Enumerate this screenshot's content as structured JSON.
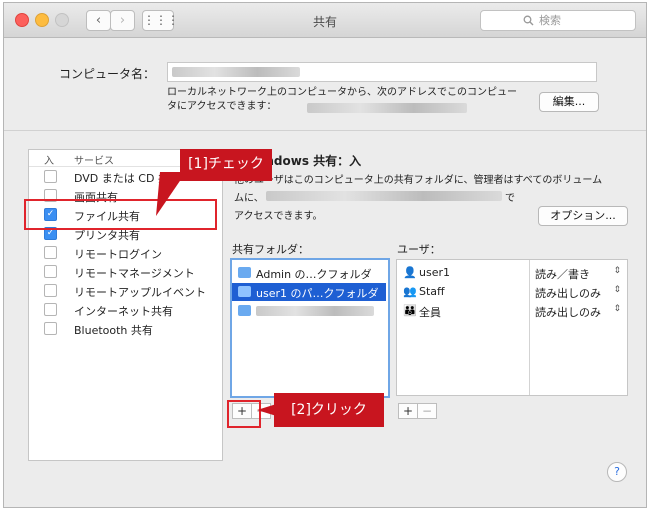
{
  "window": {
    "title": "共有",
    "search_placeholder": "検索",
    "search_icon": "magnifier-icon",
    "nav_back": "‹",
    "nav_forward": "›",
    "grid": "⋮⋮⋮"
  },
  "computer": {
    "name_label": "コンピュータ名：",
    "description": "ローカルネットワーク上のコンピュータから、次のアドレスでこのコンピュータにアクセスできます：",
    "edit_button": "編集..."
  },
  "services": {
    "header_on": "入",
    "header_service": "サービス",
    "items": [
      {
        "label": "DVD または CD 共有",
        "checked": false
      },
      {
        "label": "画面共有",
        "checked": false
      },
      {
        "label": "ファイル共有",
        "checked": true
      },
      {
        "label": "プリンタ共有",
        "checked": true
      },
      {
        "label": "リモートログイン",
        "checked": false
      },
      {
        "label": "リモートマネージメント",
        "checked": false
      },
      {
        "label": "リモートアップルイベント",
        "checked": false
      },
      {
        "label": "インターネット共有",
        "checked": false
      },
      {
        "label": "Bluetooth 共有",
        "checked": false
      }
    ]
  },
  "status": {
    "title": "Windows 共有：入",
    "description_line1": "他のユーザはこのコンピュータ上の共有フォルダに、管理者はすべてのボリューム",
    "description_line2_prefix": "ムに、",
    "description_line2_suffix": "で",
    "description_line3": "アクセスできます。",
    "options_button": "オプション..."
  },
  "shared_folders": {
    "label": "共有フォルダ：",
    "items": [
      {
        "label": "Admin の…クフォルダ",
        "selected": false
      },
      {
        "label": "user1 のパ…クフォルダ",
        "selected": true
      },
      {
        "label": "",
        "selected": false
      }
    ],
    "add_button": "+",
    "remove_button": "−"
  },
  "users": {
    "label": "ユーザ：",
    "items": [
      {
        "name": "user1",
        "permission": "読み／書き",
        "icon": "single-user-icon"
      },
      {
        "name": "Staff",
        "permission": "読み出しのみ",
        "icon": "group-icon"
      },
      {
        "name": "全員",
        "permission": "読み出しのみ",
        "icon": "everyone-icon"
      }
    ],
    "add_button": "+",
    "remove_button": "−"
  },
  "annotations": {
    "callout1": "[1]チェック",
    "callout2": "[2]クリック"
  },
  "help": "?",
  "colors": {
    "accent": "#3b8ff2",
    "selection": "#1e5fd3",
    "callout_red": "#c8151f"
  }
}
